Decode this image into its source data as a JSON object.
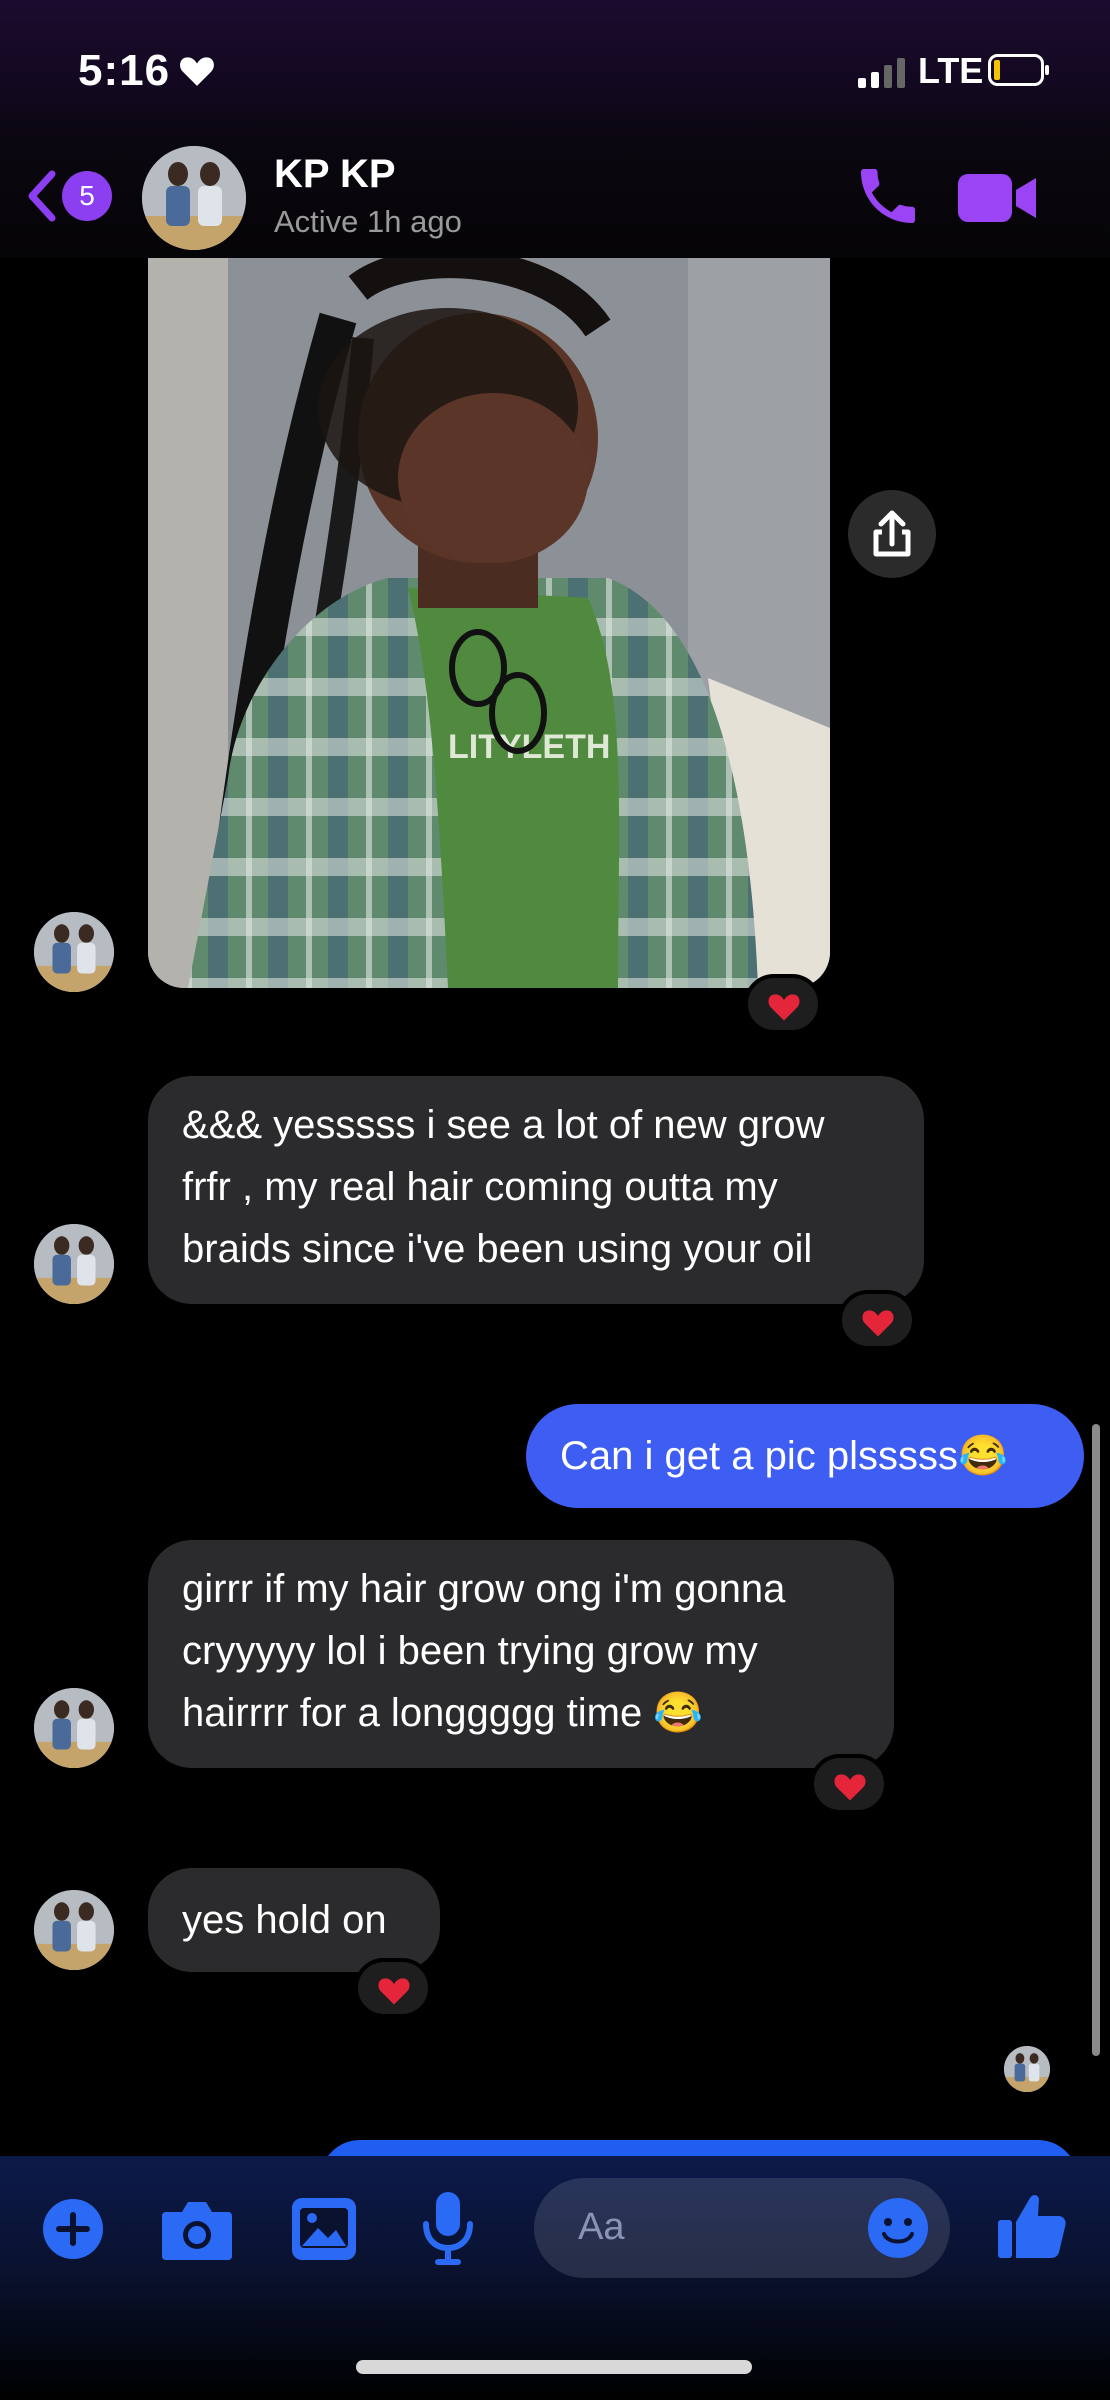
{
  "status_bar": {
    "time": "5:16",
    "network": "LTE"
  },
  "header": {
    "unread_count": "5",
    "contact_name": "KP KP",
    "active_status": "Active 1h ago"
  },
  "messages": [
    {
      "sender": "contact",
      "type": "image",
      "reaction": "heart"
    },
    {
      "sender": "contact",
      "text_lines": [
        "&&& yesssss i see a lot of new grow",
        "frfr , my real hair coming outta my",
        "braids since i've been using your oil"
      ],
      "reaction": "heart"
    },
    {
      "sender": "me",
      "text": "Can i get a pic plsssss😂"
    },
    {
      "sender": "contact",
      "text_lines": [
        "girrr if my hair grow ong i'm gonna",
        "cryyyyy lol i been trying grow my",
        "hairrrr for a longgggg time 😂"
      ],
      "reaction": "heart"
    },
    {
      "sender": "contact",
      "text": "yes hold on",
      "reaction": "heart"
    }
  ],
  "image_overlay_text": "LITYLETH",
  "composer": {
    "placeholder": "Aa"
  },
  "colors": {
    "accent_purple": "#8b3ff0",
    "outgoing_bubble": "#3e5df2",
    "incoming_bubble": "#2b2b2d",
    "composer_icons": "#2a6af5"
  }
}
